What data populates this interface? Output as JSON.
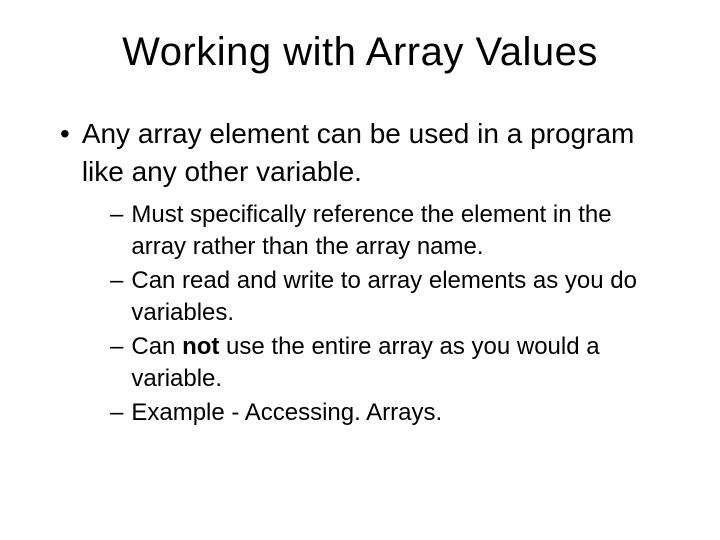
{
  "title": "Working with Array Values",
  "bullet1": {
    "text": "Any array element can be used in a program like any other variable.",
    "sub": [
      {
        "pre": "Must specifically reference the element in the array rather than the array name."
      },
      {
        "pre": "Can read and write to array elements as you do variables."
      },
      {
        "pre": "Can ",
        "bold": "not",
        "post": " use the entire array as you would a variable."
      },
      {
        "pre": "Example - Accessing. Arrays."
      }
    ]
  },
  "glyphs": {
    "dot": "•",
    "dash": "–"
  }
}
